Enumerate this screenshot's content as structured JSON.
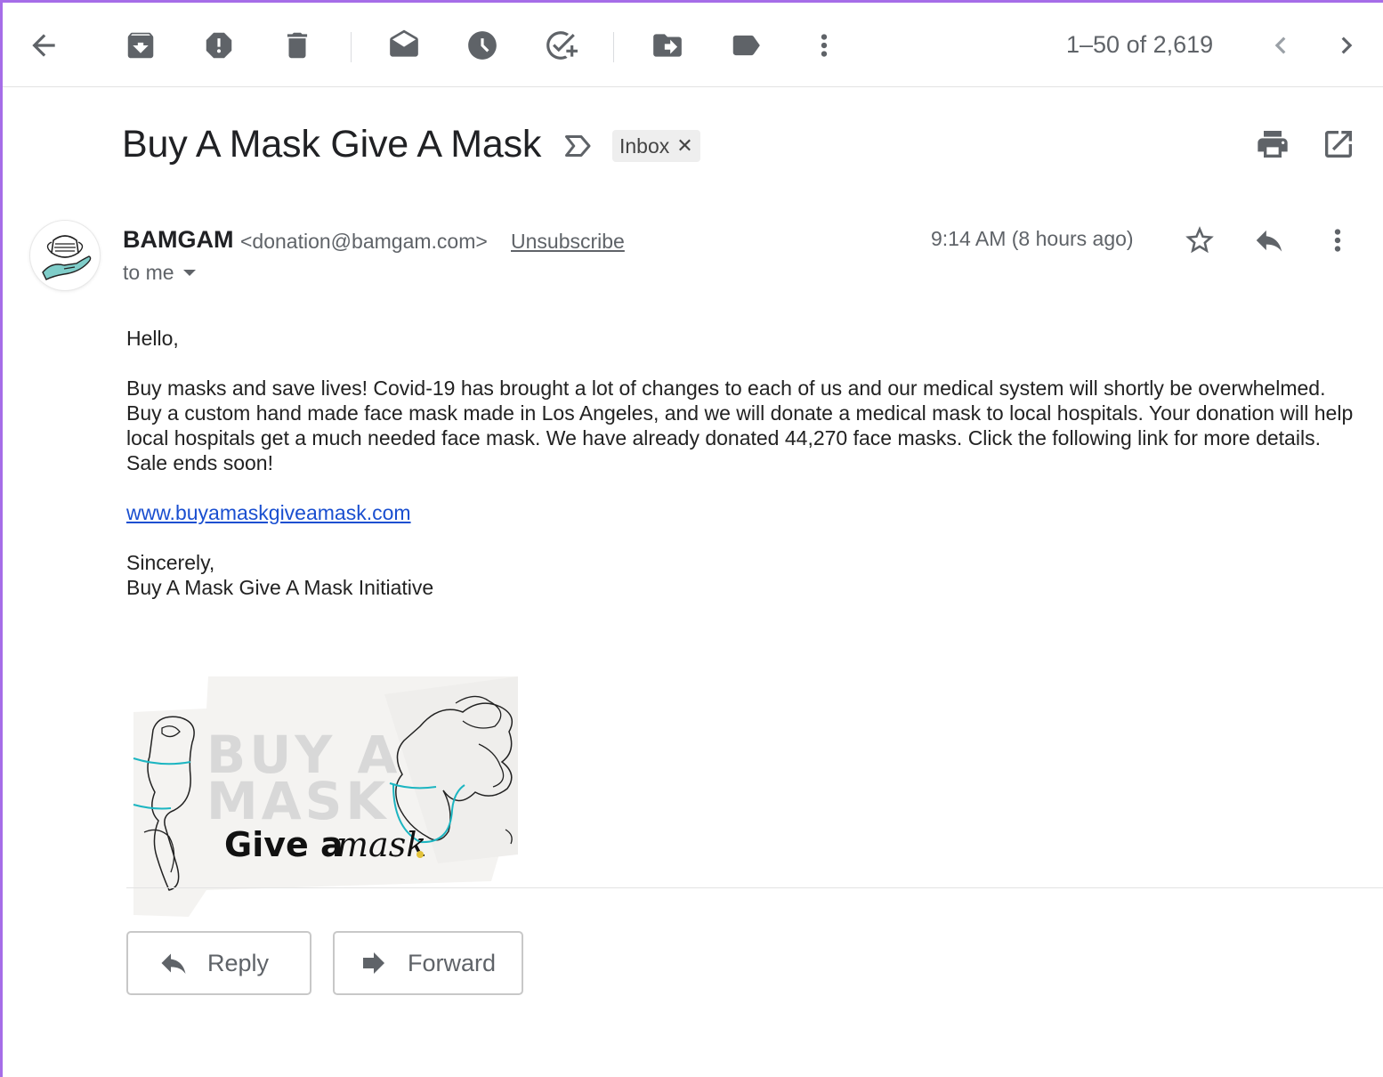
{
  "toolbar": {
    "pager_text": "1–50 of 2,619"
  },
  "email": {
    "subject": "Buy A Mask Give A Mask",
    "label_chip": "Inbox",
    "label_remove": "✕",
    "sender_name": "BAMGAM",
    "sender_email": "<donation@bamgam.com>",
    "unsubscribe": "Unsubscribe",
    "recipient": "to me",
    "date": "9:14 AM (8 hours ago)",
    "body": {
      "greeting": "Hello,",
      "paragraph": "Buy masks and save lives! Covid-19 has brought a lot of changes to each of us and our medical system will shortly be overwhelmed. Buy a custom hand made face mask made in Los Angeles, and we will donate a medical mask to local hospitals. Your donation will help local hospitals get a much needed face mask. We have already donated 44,270 face masks. Click the following link for more details. Sale ends soon!",
      "link": "www.buyamaskgiveamask.com",
      "closing": "Sincerely,",
      "signature": "Buy A Mask Give A Mask Initiative"
    },
    "banner": {
      "line1": "BUY A",
      "line2": "MASK",
      "line3_a": "Give a",
      "line3_b": "mask"
    }
  },
  "actions": {
    "reply_label": "Reply",
    "forward_label": "Forward"
  },
  "colors": {
    "accent_border": "#a66de8",
    "icon_gray": "#5f6368",
    "link_blue": "#1a4fd0",
    "mask_teal": "#1cb5c1"
  }
}
